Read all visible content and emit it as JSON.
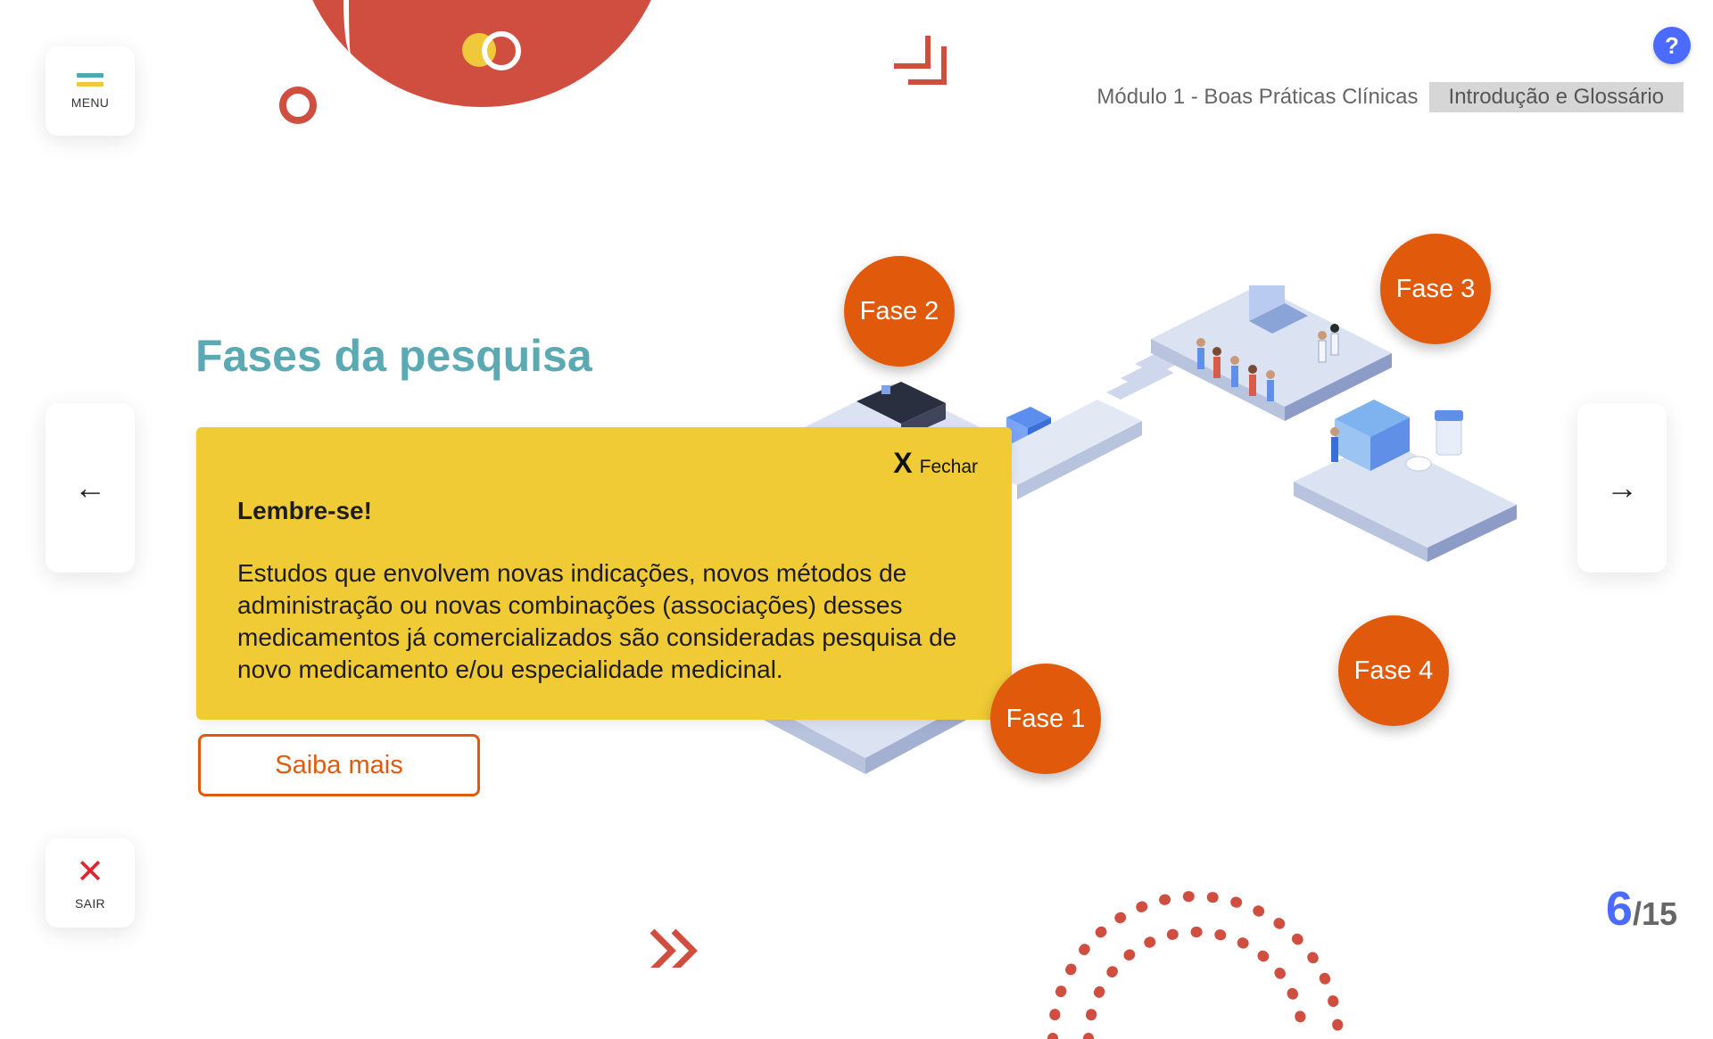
{
  "header": {
    "module": "Módulo 1 - Boas Práticas Clínicas",
    "section": "Introdução e Glossário",
    "help_label": "?"
  },
  "nav": {
    "menu_label": "MENU",
    "exit_label": "SAIR",
    "exit_icon": "✕",
    "prev_icon": "←",
    "next_icon": "→"
  },
  "main": {
    "title": "Fases da pesquisa",
    "phases": [
      "Fase 1",
      "Fase 2",
      "Fase 3",
      "Fase 4"
    ],
    "learn_more": "Saiba mais"
  },
  "modal": {
    "close_icon": "X",
    "close_label": "Fechar",
    "heading": "Lembre-se!",
    "body": "Estudos que envolvem novas indicações, novos métodos de administração ou novas combinações (associações) desses medicamentos já comercializados são consideradas pesquisa de novo medicamento e/ou especialidade medicinal."
  },
  "pagination": {
    "current": "6",
    "total": "/15"
  },
  "colors": {
    "accent_blue": "#4b6bff",
    "orange": "#e15a0c",
    "teal_title": "#5aa9b3",
    "modal_yellow": "#f0cb36",
    "deco_red": "#cf4e40"
  }
}
